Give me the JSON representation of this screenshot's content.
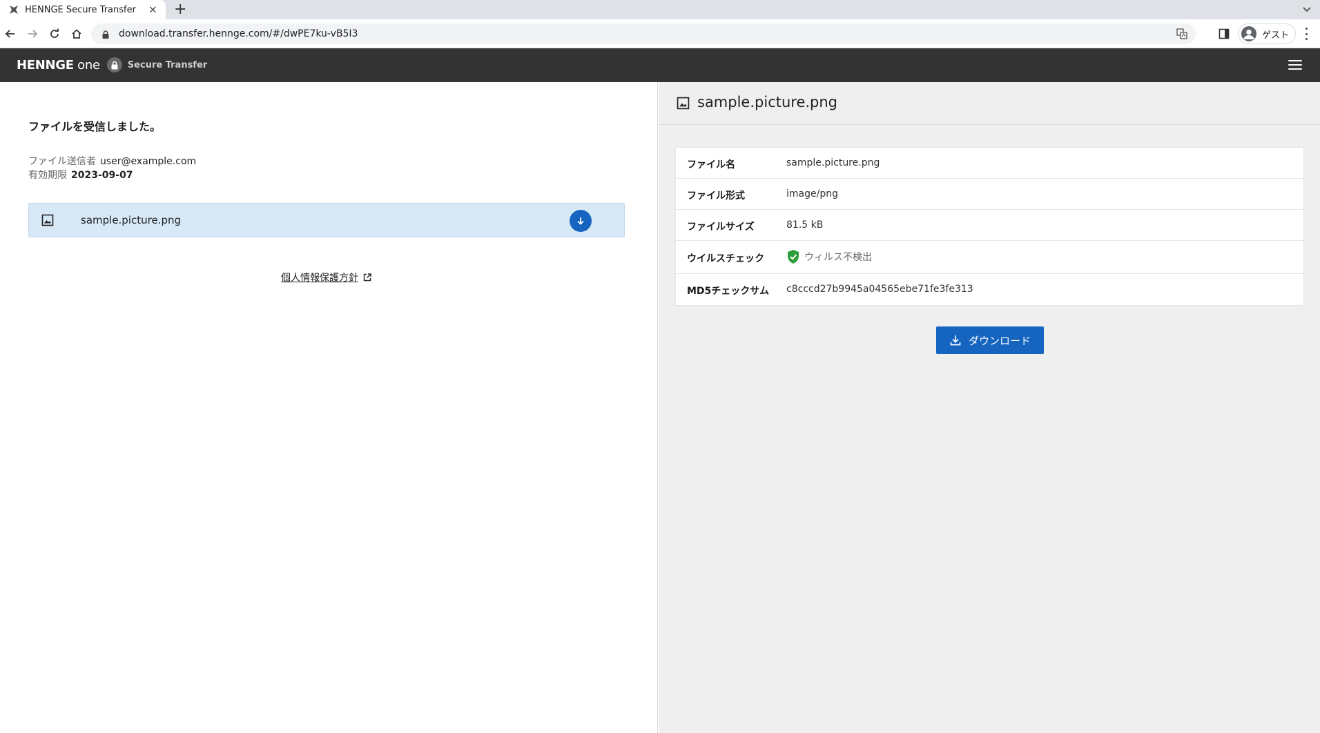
{
  "browser": {
    "tab_title": "HENNGE Secure Transfer",
    "new_tab": "+",
    "close_tab": "×",
    "url": "download.transfer.hennge.com/#/dwPE7ku-vB5I3",
    "profile_label": "ゲスト"
  },
  "header": {
    "brand_name": "HENNGE",
    "brand_suffix": " one",
    "product_name": "Secure Transfer"
  },
  "left": {
    "heading": "ファイルを受信しました。",
    "sender_label": "ファイル送信者",
    "sender_value": "user@example.com",
    "expiry_label": "有効期限",
    "expiry_value": "2023-09-07",
    "file_name": "sample.picture.png",
    "privacy_link": "個人情報保護方針"
  },
  "right": {
    "title": "sample.picture.png",
    "details": [
      {
        "key": "ファイル名",
        "value": "sample.picture.png"
      },
      {
        "key": "ファイル形式",
        "value": "image/png"
      },
      {
        "key": "ファイルサイズ",
        "value": "81.5 kB"
      },
      {
        "key": "ウイルスチェック",
        "value": "ウィルス不検出"
      },
      {
        "key": "MD5チェックサム",
        "value": "c8cccd27b9945a04565ebe71fe3fe313"
      }
    ],
    "download_label": "ダウンロード"
  },
  "colors": {
    "header_bg": "#333333",
    "accent": "#1565c0",
    "selected_row": "#d7e8f7",
    "virus_ok": "#2e9e3a"
  }
}
